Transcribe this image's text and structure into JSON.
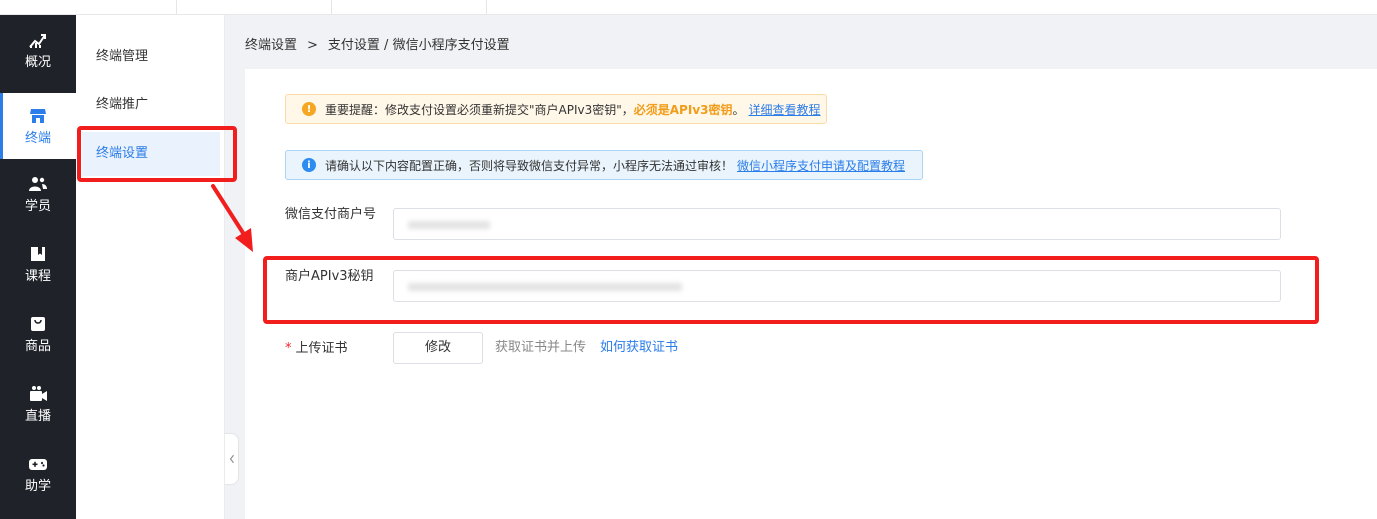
{
  "rail": {
    "items": [
      {
        "label": "概况",
        "icon": "chart-line-icon"
      },
      {
        "label": "终端",
        "icon": "store-icon",
        "active": true
      },
      {
        "label": "学员",
        "icon": "users-icon"
      },
      {
        "label": "课程",
        "icon": "book-icon"
      },
      {
        "label": "商品",
        "icon": "bag-icon"
      },
      {
        "label": "直播",
        "icon": "video-camera-icon"
      },
      {
        "label": "助学",
        "icon": "gamepad-icon"
      }
    ]
  },
  "submenu": {
    "items": [
      {
        "label": "终端管理"
      },
      {
        "label": "终端推广"
      },
      {
        "label": "终端设置",
        "active": true
      }
    ]
  },
  "breadcrumb": {
    "first": "终端设置",
    "separator": ">",
    "second": "支付设置 / 微信小程序支付设置"
  },
  "alerts": {
    "warning": {
      "text": "重要提醒：修改支付设置必须重新提交\"商户APIv3密钥\"，",
      "strong": "必须是APIv3密钥",
      "dot": "。",
      "link": "详细查看教程"
    },
    "info": {
      "text": "请确认以下内容配置正确，否则将导致微信支付异常，小程序无法通过审核！",
      "link": "微信小程序支付申请及配置教程"
    }
  },
  "form": {
    "merchant_id_label": "微信支付商户号",
    "apiv3_key_label": "商户APIv3秘钥",
    "cert_label": "上传证书",
    "required_mark": "*",
    "modify_button": "修改",
    "cert_hint": "获取证书并上传",
    "cert_link": "如何获取证书"
  },
  "colors": {
    "accent": "#2b7de9",
    "rail_bg": "#1f2329",
    "annotation_red": "#f21d1d",
    "warning": "#f29d1a"
  }
}
